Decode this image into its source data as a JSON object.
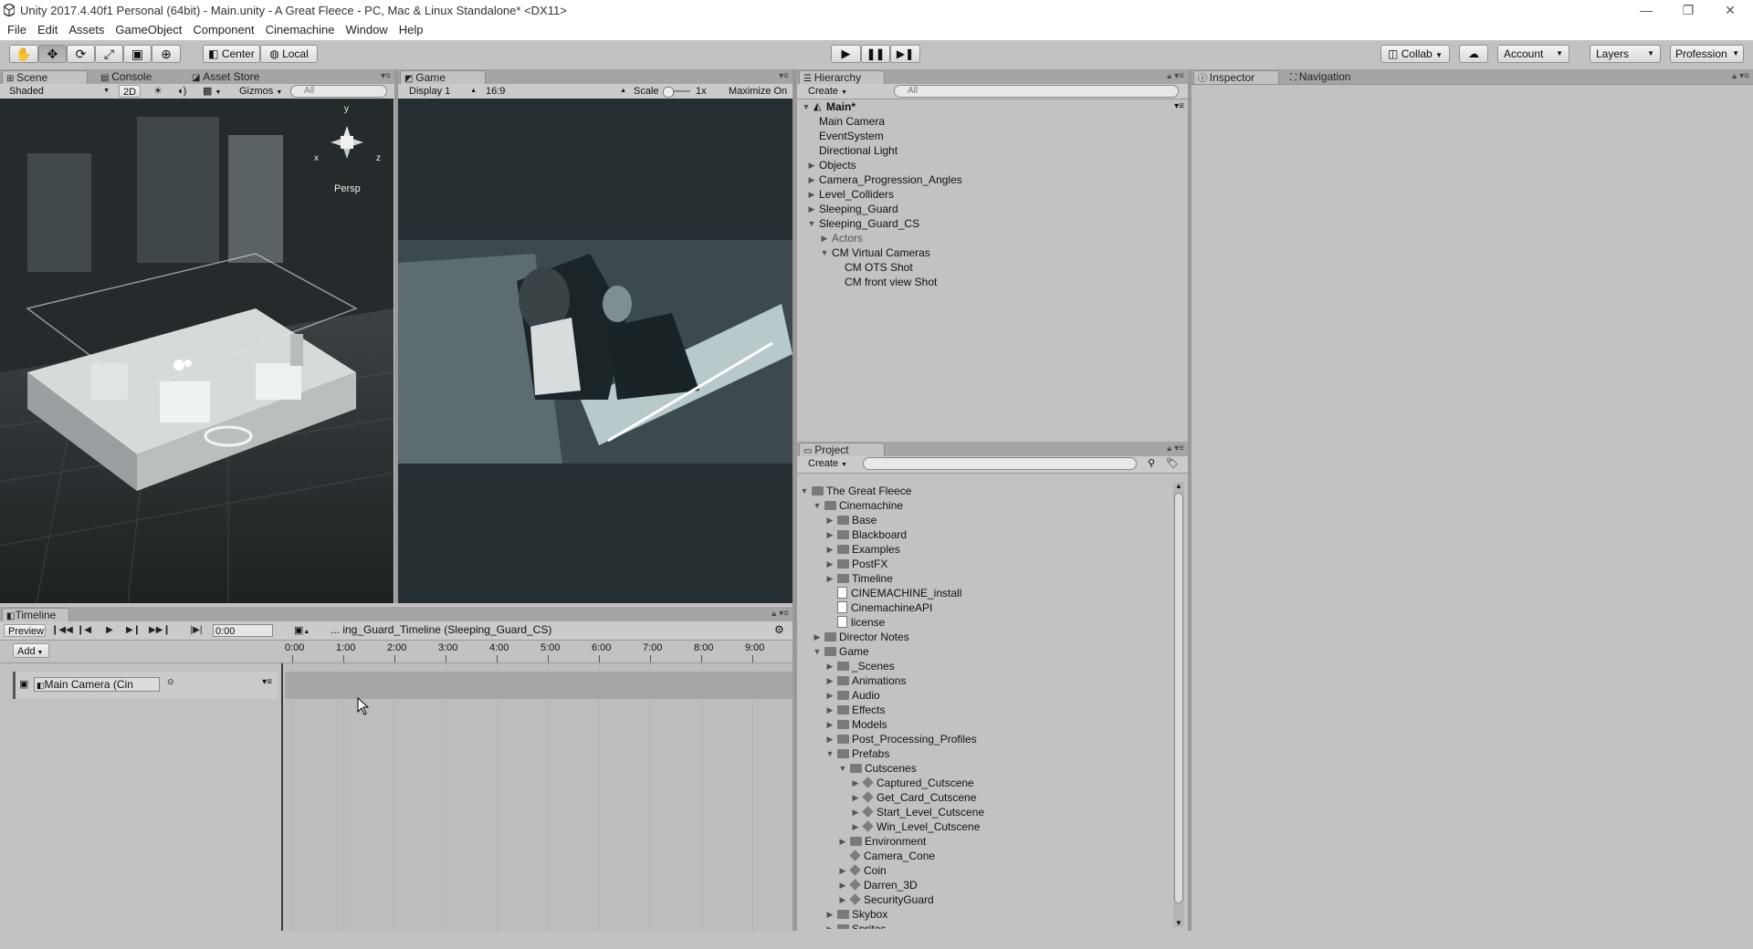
{
  "window": {
    "title": "Unity 2017.4.40f1 Personal (64bit) - Main.unity - A Great Fleece - PC, Mac & Linux Standalone* <DX11>",
    "minimize": "—",
    "maximize": "❐",
    "close": "✕"
  },
  "menu": [
    "File",
    "Edit",
    "Assets",
    "GameObject",
    "Component",
    "Cinemachine",
    "Window",
    "Help"
  ],
  "toolbar": {
    "pivot_label": "Center",
    "space_label": "Local",
    "collab_label": "Collab",
    "account_label": "Account",
    "layers_label": "Layers",
    "layout_label": "Profession"
  },
  "scene_panel": {
    "tabs": [
      "Scene",
      "Console",
      "Asset Store"
    ],
    "shading": "Shaded",
    "mode_2d": "2D",
    "gizmos": "Gizmos",
    "search_placeholder": "All",
    "axis_y": "y",
    "axis_x": "x",
    "axis_z": "z",
    "persp": "Persp"
  },
  "game_panel": {
    "tab": "Game",
    "display": "Display 1",
    "aspect": "16:9",
    "scale_label": "Scale",
    "scale_value": "1x",
    "maximize": "Maximize On"
  },
  "hierarchy": {
    "tab": "Hierarchy",
    "create": "Create",
    "search_placeholder": "All",
    "scene_name": "Main*",
    "items": [
      {
        "label": "Main Camera",
        "depth": 0,
        "arrow": ""
      },
      {
        "label": "EventSystem",
        "depth": 0,
        "arrow": ""
      },
      {
        "label": "Directional Light",
        "depth": 0,
        "arrow": ""
      },
      {
        "label": "Objects",
        "depth": 0,
        "arrow": "▶"
      },
      {
        "label": "Camera_Progression_Angles",
        "depth": 0,
        "arrow": "▶"
      },
      {
        "label": "Level_Colliders",
        "depth": 0,
        "arrow": "▶"
      },
      {
        "label": "Sleeping_Guard",
        "depth": 0,
        "arrow": "▶"
      },
      {
        "label": "Sleeping_Guard_CS",
        "depth": 0,
        "arrow": "▼"
      },
      {
        "label": "Actors",
        "depth": 1,
        "arrow": "▶",
        "dim": true
      },
      {
        "label": "CM Virtual Cameras",
        "depth": 1,
        "arrow": "▼"
      },
      {
        "label": "CM OTS Shot",
        "depth": 2,
        "arrow": ""
      },
      {
        "label": "CM front view Shot",
        "depth": 2,
        "arrow": ""
      }
    ]
  },
  "inspector": {
    "tab_inspector": "Inspector",
    "tab_navigation": "Navigation"
  },
  "project": {
    "tab": "Project",
    "create": "Create",
    "items": [
      {
        "label": "The Great Fleece",
        "depth": 0,
        "arrow": "▼",
        "kind": "folder"
      },
      {
        "label": "Cinemachine",
        "depth": 1,
        "arrow": "▼",
        "kind": "folder"
      },
      {
        "label": "Base",
        "depth": 2,
        "arrow": "▶",
        "kind": "folder"
      },
      {
        "label": "Blackboard",
        "depth": 2,
        "arrow": "▶",
        "kind": "folder"
      },
      {
        "label": "Examples",
        "depth": 2,
        "arrow": "▶",
        "kind": "folder"
      },
      {
        "label": "PostFX",
        "depth": 2,
        "arrow": "▶",
        "kind": "folder"
      },
      {
        "label": "Timeline",
        "depth": 2,
        "arrow": "▶",
        "kind": "folder"
      },
      {
        "label": "CINEMACHINE_install",
        "depth": 2,
        "arrow": "",
        "kind": "file"
      },
      {
        "label": "CinemachineAPI",
        "depth": 2,
        "arrow": "",
        "kind": "file"
      },
      {
        "label": "license",
        "depth": 2,
        "arrow": "",
        "kind": "file"
      },
      {
        "label": "Director Notes",
        "depth": 1,
        "arrow": "▶",
        "kind": "folder"
      },
      {
        "label": "Game",
        "depth": 1,
        "arrow": "▼",
        "kind": "folder"
      },
      {
        "label": "_Scenes",
        "depth": 2,
        "arrow": "▶",
        "kind": "folder"
      },
      {
        "label": "Animations",
        "depth": 2,
        "arrow": "▶",
        "kind": "folder"
      },
      {
        "label": "Audio",
        "depth": 2,
        "arrow": "▶",
        "kind": "folder"
      },
      {
        "label": "Effects",
        "depth": 2,
        "arrow": "▶",
        "kind": "folder"
      },
      {
        "label": "Models",
        "depth": 2,
        "arrow": "▶",
        "kind": "folder"
      },
      {
        "label": "Post_Processing_Profiles",
        "depth": 2,
        "arrow": "▶",
        "kind": "folder"
      },
      {
        "label": "Prefabs",
        "depth": 2,
        "arrow": "▼",
        "kind": "folder"
      },
      {
        "label": "Cutscenes",
        "depth": 3,
        "arrow": "▼",
        "kind": "folder"
      },
      {
        "label": "Captured_Cutscene",
        "depth": 4,
        "arrow": "▶",
        "kind": "prefab"
      },
      {
        "label": "Get_Card_Cutscene",
        "depth": 4,
        "arrow": "▶",
        "kind": "prefab"
      },
      {
        "label": "Start_Level_Cutscene",
        "depth": 4,
        "arrow": "▶",
        "kind": "prefab"
      },
      {
        "label": "Win_Level_Cutscene",
        "depth": 4,
        "arrow": "▶",
        "kind": "prefab"
      },
      {
        "label": "Environment",
        "depth": 3,
        "arrow": "▶",
        "kind": "folder"
      },
      {
        "label": "Camera_Cone",
        "depth": 3,
        "arrow": "",
        "kind": "prefab"
      },
      {
        "label": "Coin",
        "depth": 3,
        "arrow": "▶",
        "kind": "prefab"
      },
      {
        "label": "Darren_3D",
        "depth": 3,
        "arrow": "▶",
        "kind": "prefab"
      },
      {
        "label": "SecurityGuard",
        "depth": 3,
        "arrow": "▶",
        "kind": "prefab"
      },
      {
        "label": "Skybox",
        "depth": 2,
        "arrow": "▶",
        "kind": "folder"
      },
      {
        "label": "Sprites",
        "depth": 2,
        "arrow": "▶",
        "kind": "folder"
      }
    ]
  },
  "timeline": {
    "tab": "Timeline",
    "preview": "Preview",
    "time": "0:00",
    "asset_path": "... ing_Guard_Timeline (Sleeping_Guard_CS)",
    "add": "Add",
    "track_label": "Main Camera (Cin",
    "ticks": [
      "0:00",
      "1:00",
      "2:00",
      "3:00",
      "4:00",
      "5:00",
      "6:00",
      "7:00",
      "8:00",
      "9:00"
    ]
  }
}
